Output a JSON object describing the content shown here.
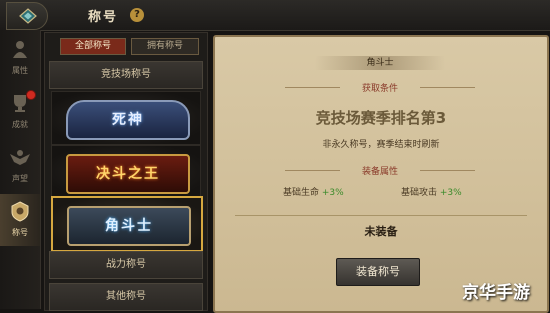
{
  "header": {
    "title": "称号",
    "help": "?"
  },
  "sidebar": {
    "items": [
      {
        "label": "属性",
        "active": false
      },
      {
        "label": "成就",
        "active": false,
        "badge": true
      },
      {
        "label": "声望",
        "active": false
      },
      {
        "label": "称号",
        "active": true
      }
    ]
  },
  "filter_tabs": {
    "all": "全部称号",
    "owned": "拥有称号"
  },
  "title_list": {
    "arena_header": "竞技场称号",
    "cards": [
      {
        "name": "死神",
        "selected": false
      },
      {
        "name": "决斗之王",
        "selected": false
      },
      {
        "name": "角斗士",
        "selected": true
      }
    ],
    "combat_header": "战力称号",
    "other_header": "其他称号"
  },
  "detail": {
    "name": "角斗士",
    "condition_label": "获取条件",
    "condition": "竞技场赛季排名第3",
    "note": "非永久称号，赛季结束时刷新",
    "attr_label": "装备属性",
    "attrs": [
      {
        "name": "基础生命",
        "value": "+3%"
      },
      {
        "name": "基础攻击",
        "value": "+3%"
      }
    ],
    "status": "未装备",
    "equip_button": "装备称号"
  },
  "watermark": "京华手游",
  "colors": {
    "accent": "#d6a840",
    "active_tab": "#7a2a1a",
    "attr_value": "#3a8a2a",
    "badge_red": "#d02a20"
  }
}
